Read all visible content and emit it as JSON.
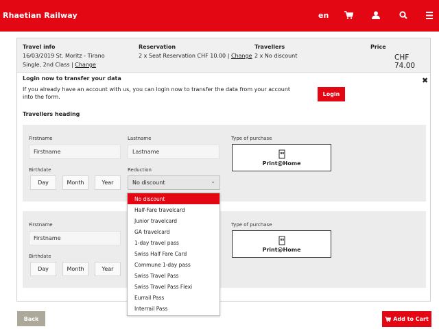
{
  "header": {
    "brand": "Rhaetian Railway",
    "language": "en",
    "icons": [
      "cart-icon",
      "user-icon",
      "search-icon",
      "menu-icon"
    ]
  },
  "summary": {
    "travel_info": {
      "heading": "Travel info",
      "route": "16/03/2019 St. Moritz - Tirano",
      "class_text": "Single, 2nd Class |",
      "change_link": "Change"
    },
    "reservation": {
      "heading": "Reservation",
      "text": "2 x Seat Reservation CHF 10.00 |",
      "change_link": "Change"
    },
    "travellers": {
      "heading": "Travellers",
      "text": "2 x No discount"
    },
    "price": {
      "heading": "Price",
      "value": "CHF 74.00"
    }
  },
  "login": {
    "title": "Login now to transfer your data",
    "text": "If you already have an account with us, you can login now to transfer the data from your account into the form.",
    "button": "Login",
    "close": "✖"
  },
  "travellers_heading": "Travellers heading",
  "traveller_form": {
    "firstname_label": "Firstname",
    "firstname_placeholder": "Firstname",
    "lastname_label": "Lastname",
    "lastname_placeholder": "Lastname",
    "birthdate_label": "Birthdate",
    "day": "Day",
    "month": "Month",
    "year": "Year",
    "reduction_label": "Reduction",
    "reduction_value": "No discount",
    "purchase_label": "Type of purchase",
    "purchase_option": "Print@Home"
  },
  "reduction_options": [
    "No discount",
    "Half-Fare travelcard",
    "Junior travelcard",
    "GA travelcard",
    "1-day travel pass",
    "Swiss Half Fare Card",
    "Commune 1-day pass",
    "Swiss Travel Pass",
    "Swiss Travel Pass Flexi",
    "Eurrail Pass",
    "Interrail Pass"
  ],
  "footer": {
    "back": "Back",
    "add_to_cart": "Add to Cart"
  },
  "colors": {
    "brand_red": "#e30613",
    "back_button": "#aca99a"
  }
}
